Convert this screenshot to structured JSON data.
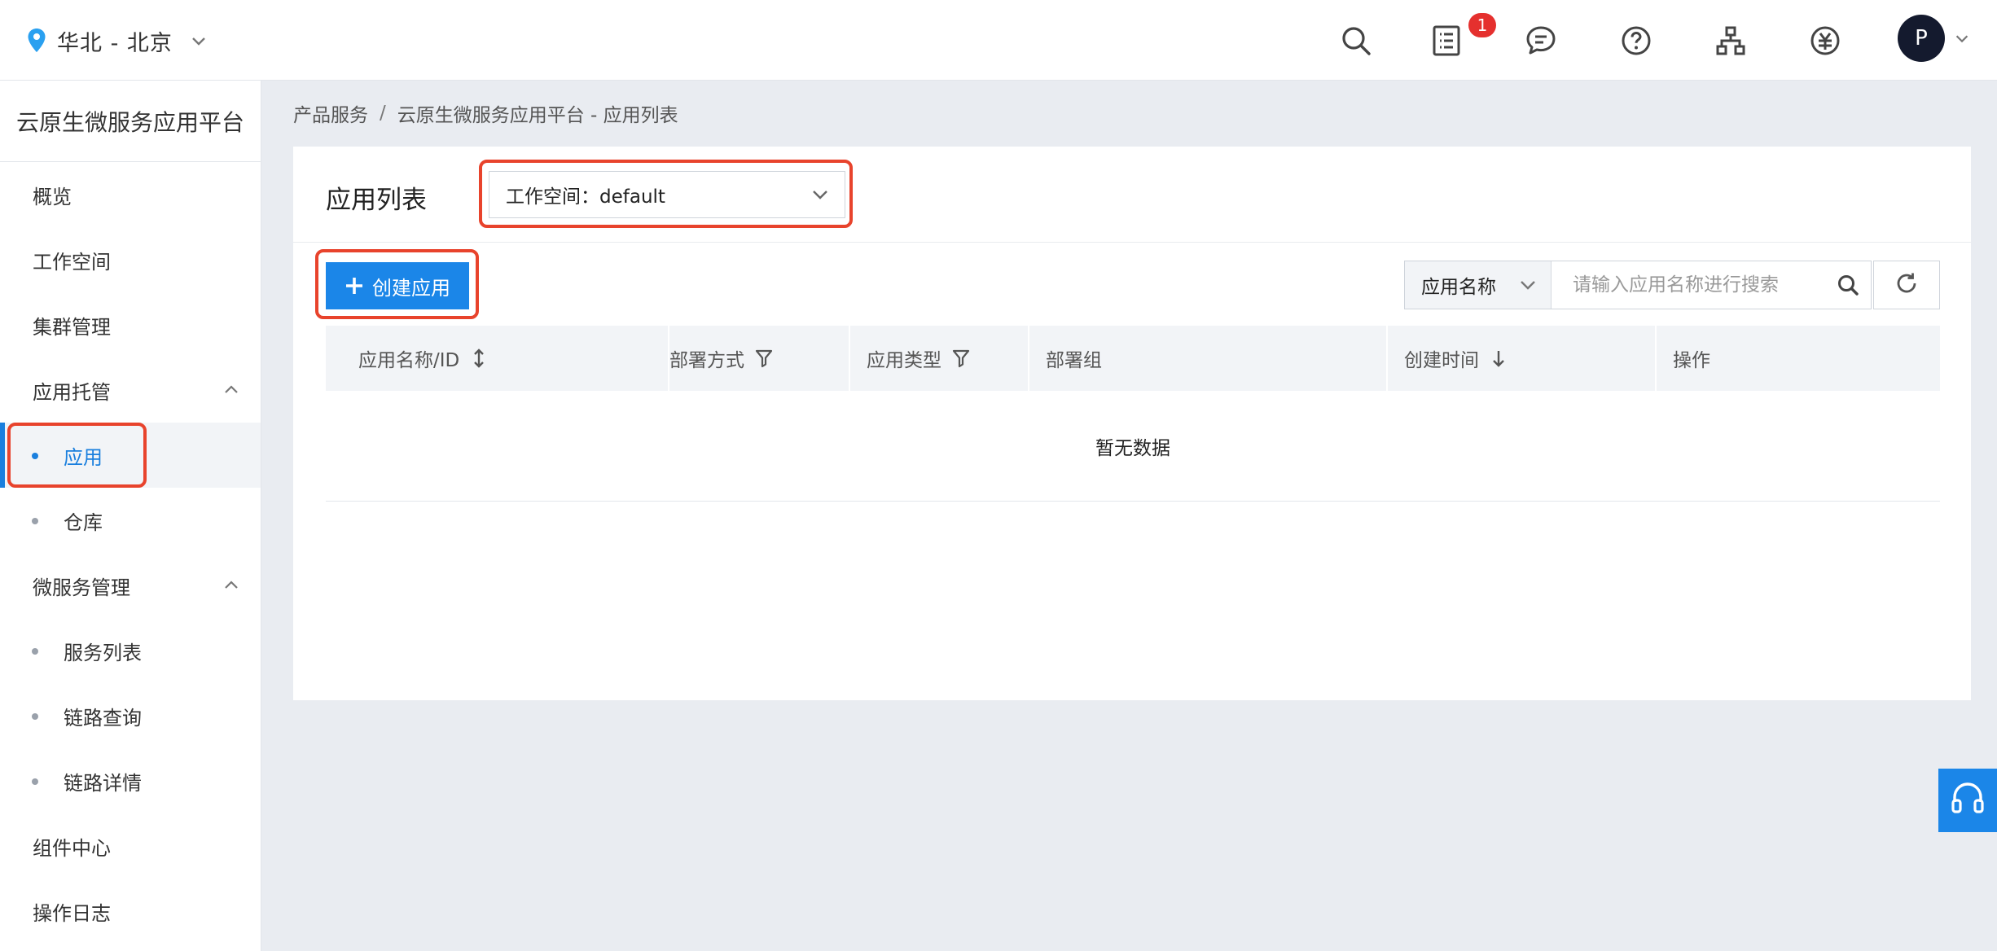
{
  "topbar": {
    "region": "华北 - 北京",
    "notification_count": "1",
    "avatar_initial": "P",
    "icons": [
      "search-icon",
      "orders-icon",
      "message-icon",
      "help-icon",
      "organization-icon",
      "billing-icon"
    ]
  },
  "sidebar": {
    "title": "云原生微服务应用平台",
    "items": {
      "overview": "概览",
      "workspace": "工作空间",
      "cluster": "集群管理",
      "app_hosting": "应用托管",
      "app": "应用",
      "repo": "仓库",
      "microservice": "微服务管理",
      "service_list": "服务列表",
      "trace_query": "链路查询",
      "trace_detail": "链路详情",
      "components": "组件中心",
      "logs": "操作日志"
    }
  },
  "breadcrumb": {
    "root": "产品服务",
    "separator": "/",
    "current": "云原生微服务应用平台 - 应用列表"
  },
  "panel": {
    "title": "应用列表",
    "workspace_select": "工作空间：default",
    "create_button": "创建应用",
    "search": {
      "type": "应用名称",
      "placeholder": "请输入应用名称进行搜索"
    },
    "table": {
      "columns": {
        "name": "应用名称/ID",
        "deploy": "部署方式",
        "type": "应用类型",
        "group": "部署组",
        "created": "创建时间",
        "ops": "操作"
      },
      "empty_text": "暂无数据"
    }
  },
  "colors": {
    "primary": "#1b86e8",
    "highlight": "#e8432c",
    "badge": "#e5302e"
  }
}
